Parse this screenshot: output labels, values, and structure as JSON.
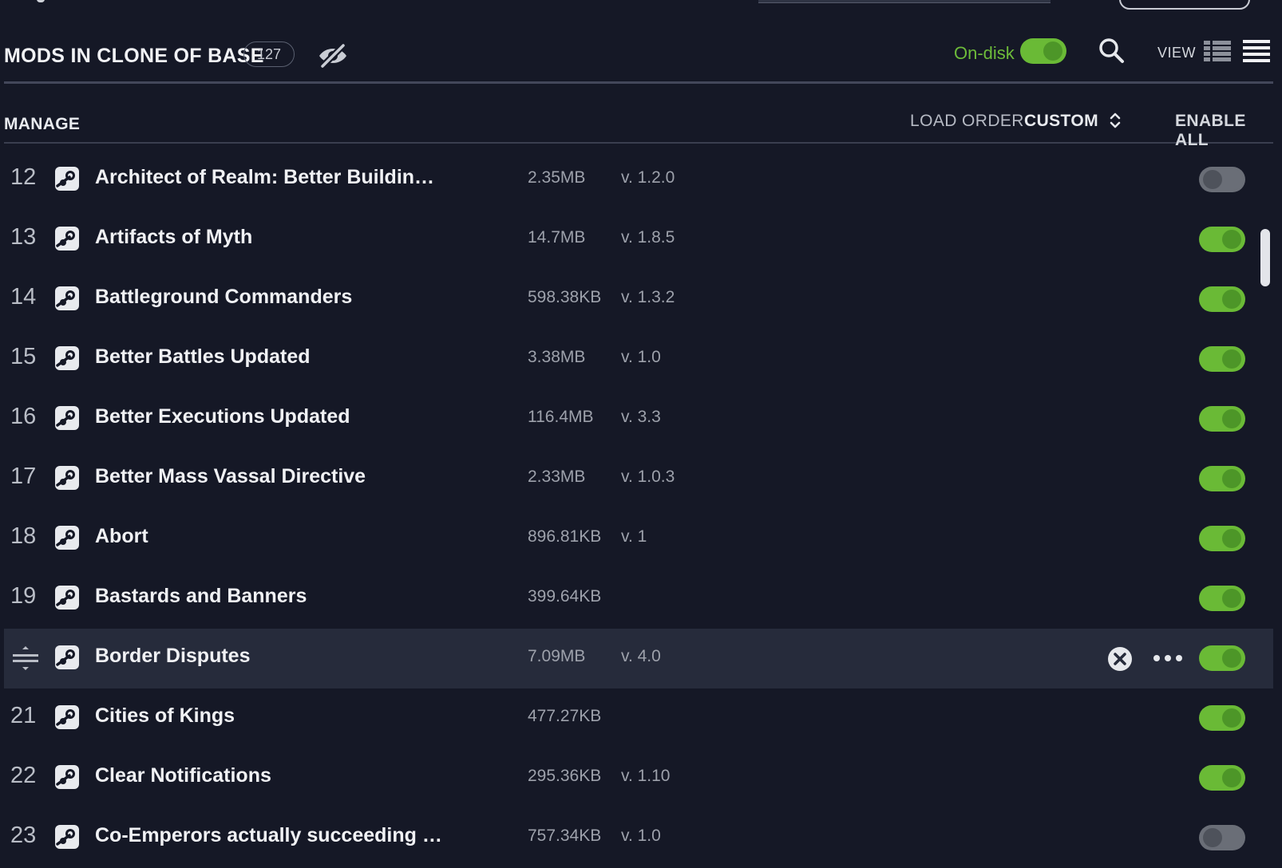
{
  "header": {
    "title": "MODS IN CLONE OF BASE",
    "count": "127",
    "ondisk_label": "On-disk",
    "ondisk_enabled": true,
    "view_label": "VIEW",
    "icons": [
      "eye-slash-icon",
      "search-icon",
      "grid-view-icon",
      "list-view-icon"
    ]
  },
  "manage": {
    "label": "MANAGE",
    "load_order_label": "LOAD ORDER",
    "load_order_value": "CUSTOM",
    "enable_all_label": "ENABLE ALL"
  },
  "colors": {
    "background": "#151826",
    "accent_green": "#6aba36",
    "toggle_off": "#6a6e77",
    "active_row": "#262b3b"
  },
  "mods": [
    {
      "num": "12",
      "name": "Architect of Realm: Better Buildin…",
      "size": "2.35MB",
      "version": "v. 1.2.0",
      "enabled": false
    },
    {
      "num": "13",
      "name": "Artifacts of Myth",
      "size": "14.7MB",
      "version": "v. 1.8.5",
      "enabled": true
    },
    {
      "num": "14",
      "name": "Battleground Commanders",
      "size": "598.38KB",
      "version": "v. 1.3.2",
      "enabled": true
    },
    {
      "num": "15",
      "name": "Better Battles Updated",
      "size": "3.38MB",
      "version": "v. 1.0",
      "enabled": true
    },
    {
      "num": "16",
      "name": "Better Executions Updated",
      "size": "116.4MB",
      "version": "v. 3.3",
      "enabled": true
    },
    {
      "num": "17",
      "name": "Better Mass Vassal Directive",
      "size": "2.33MB",
      "version": "v. 1.0.3",
      "enabled": true
    },
    {
      "num": "18",
      "name": "Abort",
      "size": "896.81KB",
      "version": "v. 1",
      "enabled": true
    },
    {
      "num": "19",
      "name": "Bastards and Banners",
      "size": "399.64KB",
      "version": "",
      "enabled": true
    },
    {
      "num": "",
      "name": "Border Disputes",
      "size": "7.09MB",
      "version": "v. 4.0",
      "enabled": true,
      "active": true
    },
    {
      "num": "21",
      "name": "Cities of Kings",
      "size": "477.27KB",
      "version": "",
      "enabled": true
    },
    {
      "num": "22",
      "name": "Clear Notifications",
      "size": "295.36KB",
      "version": "v. 1.10",
      "enabled": true
    },
    {
      "num": "23",
      "name": "Co-Emperors actually succeeding …",
      "size": "757.34KB",
      "version": "v. 1.0",
      "enabled": false
    }
  ]
}
